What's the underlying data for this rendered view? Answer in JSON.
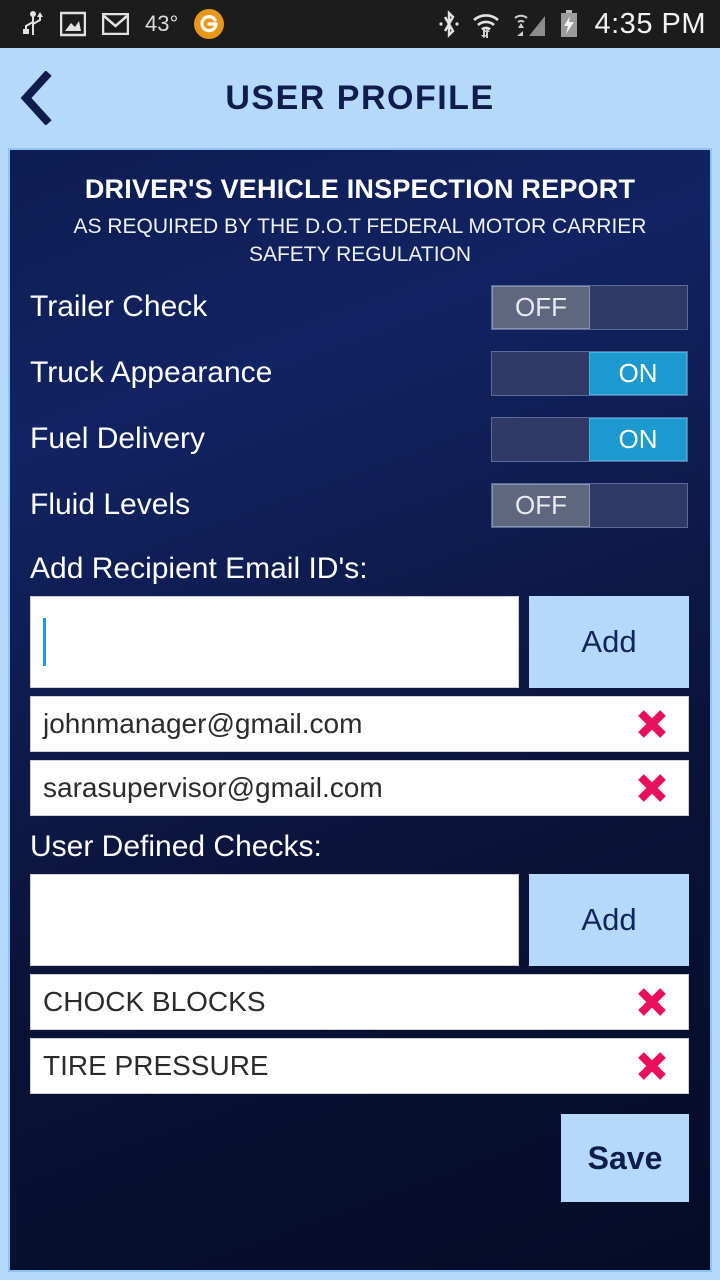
{
  "status_bar": {
    "temperature": "43°",
    "clock": "4:35 PM",
    "left_icons": [
      "usb-icon",
      "screenshot-icon",
      "gmail-icon",
      "weather-temp",
      "app-circle-icon"
    ],
    "right_icons": [
      "bluetooth-icon",
      "wifi-icon",
      "cell-signal-icon",
      "battery-charging-icon"
    ],
    "background": "#1c1c1c"
  },
  "header": {
    "title": "USER PROFILE",
    "back_icon": "chevron-left-icon",
    "background": "#b4d9fb",
    "text_color": "#101c4e"
  },
  "report": {
    "title": "DRIVER'S VEHICLE INSPECTION REPORT",
    "subtitle": "AS REQUIRED BY THE D.O.T FEDERAL MOTOR CARRIER SAFETY REGULATION"
  },
  "toggles": [
    {
      "label": "Trailer Check",
      "state": "OFF",
      "on": false
    },
    {
      "label": "Truck Appearance",
      "state": "ON",
      "on": true
    },
    {
      "label": "Fuel Delivery",
      "state": "ON",
      "on": true
    },
    {
      "label": "Fluid Levels",
      "state": "OFF",
      "on": false
    }
  ],
  "email_section": {
    "label": "Add Recipient Email ID's:",
    "input_value": "",
    "input_placeholder": "",
    "add_label": "Add",
    "focused": true,
    "items": [
      {
        "text": "johnmanager@gmail.com",
        "delete_icon": "delete-x-icon"
      },
      {
        "text": "sarasupervisor@gmail.com",
        "delete_icon": "delete-x-icon"
      }
    ]
  },
  "checks_section": {
    "label": "User Defined Checks:",
    "input_value": "",
    "input_placeholder": "",
    "add_label": "Add",
    "focused": false,
    "items": [
      {
        "text": "CHOCK BLOCKS",
        "delete_icon": "delete-x-icon"
      },
      {
        "text": "TIRE PRESSURE",
        "delete_icon": "delete-x-icon"
      }
    ]
  },
  "footer": {
    "save_label": "Save"
  },
  "colors": {
    "accent_light_blue": "#b4d9fb",
    "panel_navy": "#0d1d52",
    "toggle_on": "#1c9ad0",
    "toggle_off": "#5e6680",
    "delete_red": "#e8105a",
    "title_navy": "#101c4e"
  }
}
